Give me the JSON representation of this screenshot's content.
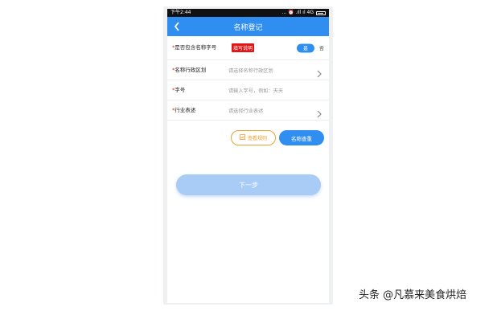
{
  "status_bar": {
    "time": "下午2:44",
    "indicators": "... ⏰ .ıll ıl 4G"
  },
  "header": {
    "title": "名称登记"
  },
  "form": {
    "rows": [
      {
        "required_mark": "*",
        "label": "是否包含名称字号",
        "badge": "填写说明",
        "yes_label": "是",
        "no_label": "否",
        "selected": "是"
      },
      {
        "required_mark": "*",
        "label": "名称行政区划",
        "placeholder": "请选择名称行政区划"
      },
      {
        "required_mark": "*",
        "label": "字号",
        "placeholder": "请输入字号，例如：天天"
      },
      {
        "required_mark": "*",
        "label": "行业表述",
        "placeholder": "请选择行业表述"
      }
    ]
  },
  "actions": {
    "rules_label": "查看规则",
    "check_label": "名称查重"
  },
  "footer": {
    "next_label": "下一步"
  },
  "watermark": "头条 @凡慕来美食烘焙",
  "colors": {
    "accent": "#2f8ef0",
    "warning": "#f0a030",
    "badge_red": "#e01515",
    "next_disabled": "#a8ccf6"
  }
}
